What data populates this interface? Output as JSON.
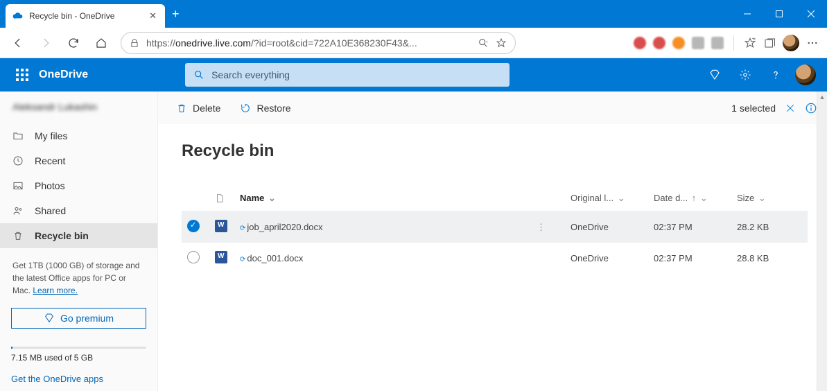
{
  "browser": {
    "tab_title": "Recycle bin - OneDrive",
    "url_display_prefix": "https://",
    "url_display_host": "onedrive.live.com",
    "url_display_rest": "/?id=root&cid=722A10E368230F43&...",
    "new_tab_label": "+"
  },
  "header": {
    "brand": "OneDrive",
    "search_placeholder": "Search everything"
  },
  "sidebar": {
    "user_name": "Aleksandr Lukashin",
    "items": [
      {
        "label": "My files"
      },
      {
        "label": "Recent"
      },
      {
        "label": "Photos"
      },
      {
        "label": "Shared"
      },
      {
        "label": "Recycle bin"
      }
    ],
    "promo_text": "Get 1TB (1000 GB) of storage and the latest Office apps for PC or Mac.",
    "learn_more": "Learn more.",
    "premium_button": "Go premium",
    "storage_used": "7.15 MB",
    "storage_mid": " used of ",
    "storage_total": "5 GB",
    "apps_link": "Get the OneDrive apps"
  },
  "commands": {
    "delete": "Delete",
    "restore": "Restore",
    "selected_label": "1 selected"
  },
  "page": {
    "title": "Recycle bin",
    "columns": {
      "name": "Name",
      "location": "Original l...",
      "date": "Date d...",
      "size": "Size"
    },
    "rows": [
      {
        "selected": true,
        "name": "job_april2020.docx",
        "location": "OneDrive",
        "date": "02:37 PM",
        "size": "28.2 KB"
      },
      {
        "selected": false,
        "name": "doc_001.docx",
        "location": "OneDrive",
        "date": "02:37 PM",
        "size": "28.8 KB"
      }
    ]
  }
}
